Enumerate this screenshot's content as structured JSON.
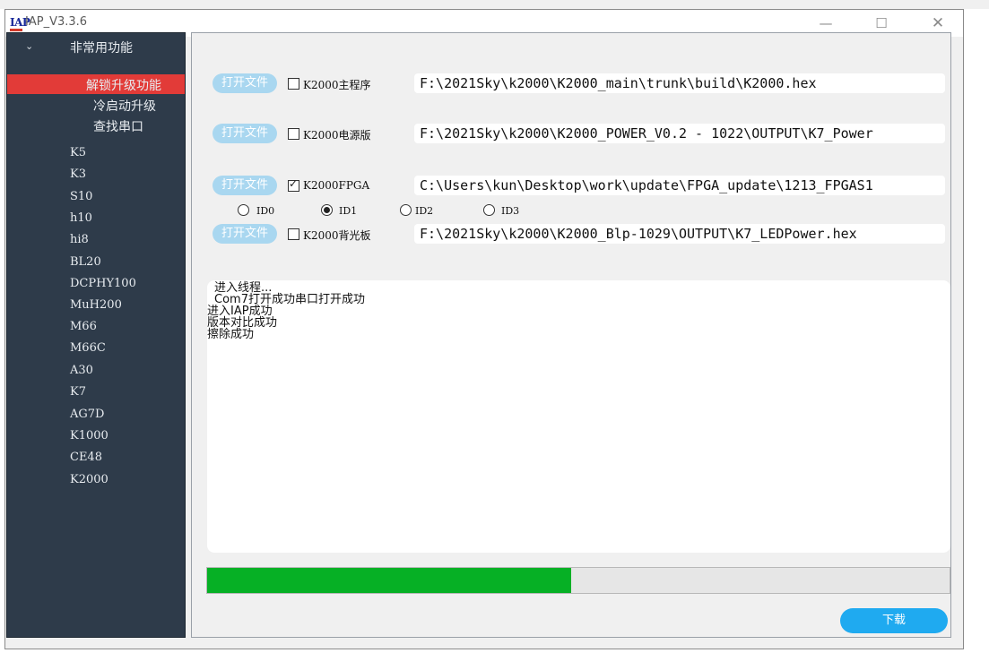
{
  "window": {
    "title": "IAP_V3.3.6",
    "logo": "IAP",
    "controls": {
      "minimize": "—",
      "maximize": "☐",
      "close": "✕"
    }
  },
  "sidebar": {
    "group_toggle": "v",
    "group_label": "非常用功能",
    "children": [
      {
        "label": "解锁升级功能",
        "selected": true
      },
      {
        "label": "冷启动升级",
        "selected": false
      },
      {
        "label": "查找串口",
        "selected": false
      }
    ],
    "items": [
      "K5",
      "K3",
      "S10",
      "h10",
      "hi8",
      "BL20",
      "DCPHY100",
      "MuH200",
      "M66",
      "M66C",
      "A30",
      "K7",
      "AG7D",
      "K1000",
      "CE48",
      "K2000"
    ]
  },
  "files": [
    {
      "button": "打开文件",
      "checked": false,
      "label": "K2000主程序",
      "path": "F:\\2021Sky\\k2000\\K2000_main\\trunk\\build\\K2000.hex"
    },
    {
      "button": "打开文件",
      "checked": false,
      "label": "K2000电源版",
      "path": "F:\\2021Sky\\k2000\\K2000_POWER_V0.2 - 1022\\OUTPUT\\K7_Power"
    },
    {
      "button": "打开文件",
      "checked": true,
      "label": "K2000FPGA",
      "path": "C:\\Users\\kun\\Desktop\\work\\update\\FPGA_update\\1213_FPGAS1"
    },
    {
      "button": "打开文件",
      "checked": false,
      "label": "K2000背光板",
      "path": "F:\\2021Sky\\k2000\\K2000_Blp-1029\\OUTPUT\\K7_LEDPower.hex"
    }
  ],
  "id_options": [
    {
      "label": "ID0",
      "checked": false
    },
    {
      "label": "ID1",
      "checked": true
    },
    {
      "label": "ID2",
      "checked": false
    },
    {
      "label": "ID3",
      "checked": false
    }
  ],
  "log": [
    "进入线程...",
    "Com7打开成功串口打开成功",
    "进入IAP成功",
    "版本对比成功",
    "擦除成功"
  ],
  "progress": {
    "value": 0.49,
    "color": "#06b025"
  },
  "download_button": "下载",
  "colors": {
    "sidebar_bg": "#2e3b4a",
    "selected_bg": "#e23b38",
    "button_blue": "#1faaf0",
    "open_button": "#a9d7f0"
  }
}
